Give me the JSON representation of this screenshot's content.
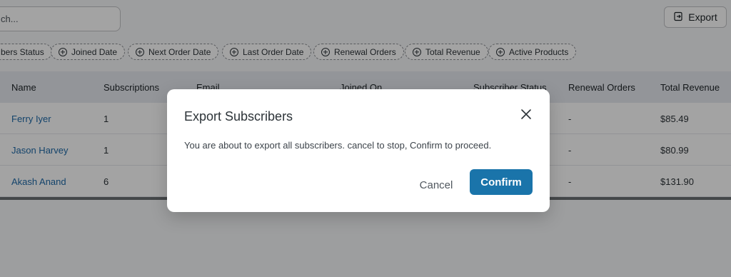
{
  "search": {
    "value": "ch..."
  },
  "toolbar": {
    "export_label": "Export",
    "export_icon": "export-icon"
  },
  "filters": [
    "bers Status",
    "Joined Date",
    "Next Order Date",
    "Last Order Date",
    "Renewal Orders",
    "Total Revenue",
    "Active Products"
  ],
  "table": {
    "columns": [
      "Name",
      "Subscriptions",
      "Email",
      "Joined On",
      "Subscriber Status",
      "Renewal Orders",
      "Total Revenue"
    ],
    "rows": [
      {
        "name": "Ferry Iyer",
        "subscriptions": "1",
        "renewal_orders": "-",
        "total_revenue": "$85.49"
      },
      {
        "name": "Jason Harvey",
        "subscriptions": "1",
        "renewal_orders": "-",
        "total_revenue": "$80.99"
      },
      {
        "name": "Akash Anand",
        "subscriptions": "6",
        "renewal_orders": "-",
        "total_revenue": "$131.90"
      }
    ]
  },
  "modal": {
    "title": "Export Subscribers",
    "message": "You are about to export all subscribers. cancel to stop, Confirm to proceed.",
    "cancel_label": "Cancel",
    "confirm_label": "Confirm",
    "close_icon": "close-icon"
  },
  "colors": {
    "accent": "#1a74aa",
    "link": "#1f6aa8",
    "header_bg": "#e6e9ef",
    "overlay": "rgba(0,0,0,0.36)"
  }
}
